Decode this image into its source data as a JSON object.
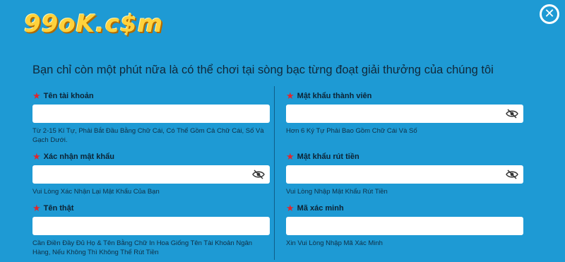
{
  "brand": {
    "logo_text": "99oK.c$m"
  },
  "close": {
    "symbol": "✕"
  },
  "headline": "Bạn chỉ còn một phút nữa là có thể chơi tại sòng bạc từng đoạt giải thưởng của chúng tôi",
  "fields": {
    "username": {
      "label": "Tên tài khoản",
      "hint": "Từ 2-15 Kí Tự, Phải Bắt Đầu Bằng Chữ Cái, Có Thể Gồm Cả Chữ Cái, Số Và Gạch Dưới."
    },
    "password": {
      "label": "Mật khẩu thành viên",
      "hint": "Hơn 6 Ký Tự Phải Bao Gồm Chữ Cái Và Số"
    },
    "confirm": {
      "label": "Xác nhận mật khẩu",
      "hint": "Vui Lòng Xác Nhận Lại Mật Khẩu Của Bạn"
    },
    "withdraw": {
      "label": "Mật khẩu rút tiền",
      "hint": "Vui Lòng Nhập Mật Khẩu Rút Tiền"
    },
    "realname": {
      "label": "Tên thật",
      "hint": "Cần Điền Đầy Đủ Họ & Tên Bằng Chữ In Hoa Giống Tên Tài Khoản Ngân Hàng, Nếu Không Thì Không Thể Rút Tiền"
    },
    "captcha": {
      "label": "Mã xác minh",
      "hint": "Xin Vui Lòng Nhập Mã Xác Minh"
    }
  },
  "required_marker": "★",
  "icons": {
    "close": "close-icon",
    "eye_off": "eye-off-icon",
    "required": "star-icon"
  },
  "colors": {
    "background": "#1e9ad4",
    "required": "#e0262d",
    "logo": "#ffd23c"
  }
}
